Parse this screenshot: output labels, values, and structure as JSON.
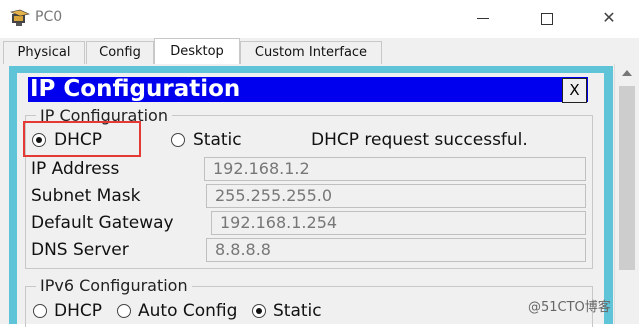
{
  "window": {
    "title": "PC0",
    "icon": "packet-tracer-pc-icon"
  },
  "tabs": [
    {
      "label": "Physical",
      "active": false
    },
    {
      "label": "Config",
      "active": false
    },
    {
      "label": "Desktop",
      "active": true
    },
    {
      "label": "Custom Interface",
      "active": false
    }
  ],
  "ip_config": {
    "header": "IP Configuration",
    "close_label": "X",
    "group_title": "IP Configuration",
    "dhcp_label": "DHCP",
    "static_label": "Static",
    "mode_selected": "DHCP",
    "status": "DHCP request successful.",
    "ip_address": {
      "label": "IP Address",
      "value": "192.168.1.2"
    },
    "subnet_mask": {
      "label": "Subnet Mask",
      "value": "255.255.255.0"
    },
    "default_gateway": {
      "label": "Default Gateway",
      "value": "192.168.1.254"
    },
    "dns_server": {
      "label": "DNS Server",
      "value": "8.8.8.8"
    }
  },
  "ipv6_config": {
    "group_title": "IPv6 Configuration",
    "dhcp_label": "DHCP",
    "auto_config_label": "Auto Config",
    "static_label": "Static",
    "mode_selected": "Static"
  },
  "watermark": "@51CTO博客",
  "colors": {
    "header_blue": "#0000ee",
    "frame_cyan": "#60c4d8",
    "highlight_red": "#e53935"
  }
}
